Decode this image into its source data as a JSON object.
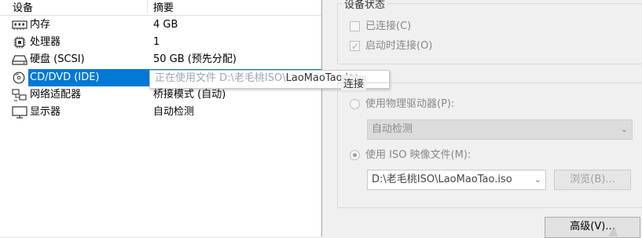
{
  "device_list": {
    "header_device": "设备",
    "header_summary": "摘要",
    "rows": [
      {
        "name": "内存",
        "summary": "4 GB",
        "icon": "memory-icon"
      },
      {
        "name": "处理器",
        "summary": "1",
        "icon": "processor-icon"
      },
      {
        "name": "硬盘 (SCSI)",
        "summary": "50 GB (预先分配)",
        "icon": "hard-disk-icon"
      },
      {
        "name": "CD/DVD (IDE)",
        "summary": "",
        "icon": "cd-dvd-icon",
        "selected": true
      },
      {
        "name": "网络适配器",
        "summary": "桥接模式 (自动)",
        "icon": "network-adapter-icon"
      },
      {
        "name": "显示器",
        "summary": "自动检测",
        "icon": "display-icon"
      }
    ],
    "tooltip_faded": "正在使用文件 D:\\老毛桃ISO\\",
    "tooltip_solid": "LaoMaoTao.iso"
  },
  "device_status": {
    "title": "设备状态",
    "connected_label": "已连接(C)",
    "connect_at_power_on_label": "启动时连接(O)"
  },
  "connection": {
    "title": "连接",
    "physical_drive_label": "使用物理驱动器(P):",
    "physical_drive_value": "自动检测",
    "iso_label": "使用 ISO 映像文件(M):",
    "iso_path": "D:\\老毛桃ISO\\LaoMaoTao.iso",
    "browse_label": "浏览(B)..."
  },
  "advanced_label": "高级(V)...",
  "colors": {
    "selection": "#0078d7",
    "window_bg": "#f0f0f0"
  }
}
